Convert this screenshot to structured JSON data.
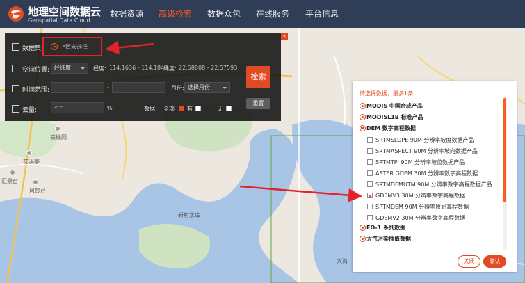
{
  "brand": {
    "name_cn": "地理空间数据云",
    "name_en": "Geospatial Data Cloud",
    "logo_icon": "globe-logo-icon"
  },
  "nav": [
    {
      "label": "数据资源",
      "active": false
    },
    {
      "label": "高级检索",
      "active": true
    },
    {
      "label": "数据众包",
      "active": false
    },
    {
      "label": "在线服务",
      "active": false
    },
    {
      "label": "平台信息",
      "active": false
    }
  ],
  "map": {
    "labels": [
      "海月",
      "铁线网",
      "花溪亭",
      "汇景台",
      "风铃台",
      "新村水库",
      "大海"
    ]
  },
  "search": {
    "dataset_label": "数据集:",
    "dataset_value": "*暂未选择",
    "location_label": "空间位置:",
    "location_mode": "经纬度",
    "lon_label": "经度:",
    "lon_value": "114.1636 - 114.1845",
    "lat_label": "纬度:",
    "lat_value": "22.58808 - 22.57593",
    "time_label": "时间范围:",
    "time_from": "",
    "time_sep": "-",
    "time_to": "",
    "month_label": "月份:",
    "month_value": "选择月份",
    "cloud_label": "云量:",
    "cloud_value": "<=",
    "cloud_unit": "%",
    "data_label": "数据:",
    "data_options": [
      {
        "label": "全部",
        "checked": true
      },
      {
        "label": "有",
        "checked": false
      },
      {
        "label": "无",
        "checked": false
      }
    ],
    "search_button": "检索",
    "reset_button": "重置",
    "close_icon": "«"
  },
  "dropdown": {
    "title": "请选择数据，最多1条",
    "items": [
      {
        "type": "cat",
        "label": "MODIS 中国合成产品",
        "icon": "circle-plus-icon"
      },
      {
        "type": "cat",
        "label": "MODISL1B 标准产品",
        "icon": "circle-plus-icon"
      },
      {
        "type": "cat",
        "label": "DEM 数字高程数据",
        "icon": "circle-minus-icon"
      },
      {
        "type": "sub",
        "label": "SRTMSLOPE 90M 分辨率坡度数据产品",
        "checked": false
      },
      {
        "type": "sub",
        "label": "SRTMASPECT 90M 分辨率坡向数据产品",
        "checked": false
      },
      {
        "type": "sub",
        "label": "SRTMTPI 90M 分辨率坡位数据产品",
        "checked": false
      },
      {
        "type": "sub",
        "label": "ASTER GDEM 30M 分辨率数字高程数据",
        "checked": false
      },
      {
        "type": "sub",
        "label": "SRTMDEMUTM 90M 分辨率数字高程数据产品",
        "checked": false
      },
      {
        "type": "sub",
        "label": "GDEMV3 30M 分辨率数字高程数据",
        "checked": true
      },
      {
        "type": "sub",
        "label": "SRTMDEM 90M 分辨率原始高程数据",
        "checked": false
      },
      {
        "type": "sub",
        "label": "GDEMV2 30M 分辨率数字高程数据",
        "checked": false
      },
      {
        "type": "cat",
        "label": "EO-1 系列数据",
        "icon": "circle-plus-icon"
      },
      {
        "type": "cat",
        "label": "大气污染插值数据",
        "icon": "circle-plus-icon"
      }
    ],
    "close_button": "关闭",
    "confirm_button": "确认"
  },
  "colors": {
    "accent": "#e14b23",
    "nav_bg": "#2f3e56",
    "annotation_red": "#e5222a"
  }
}
